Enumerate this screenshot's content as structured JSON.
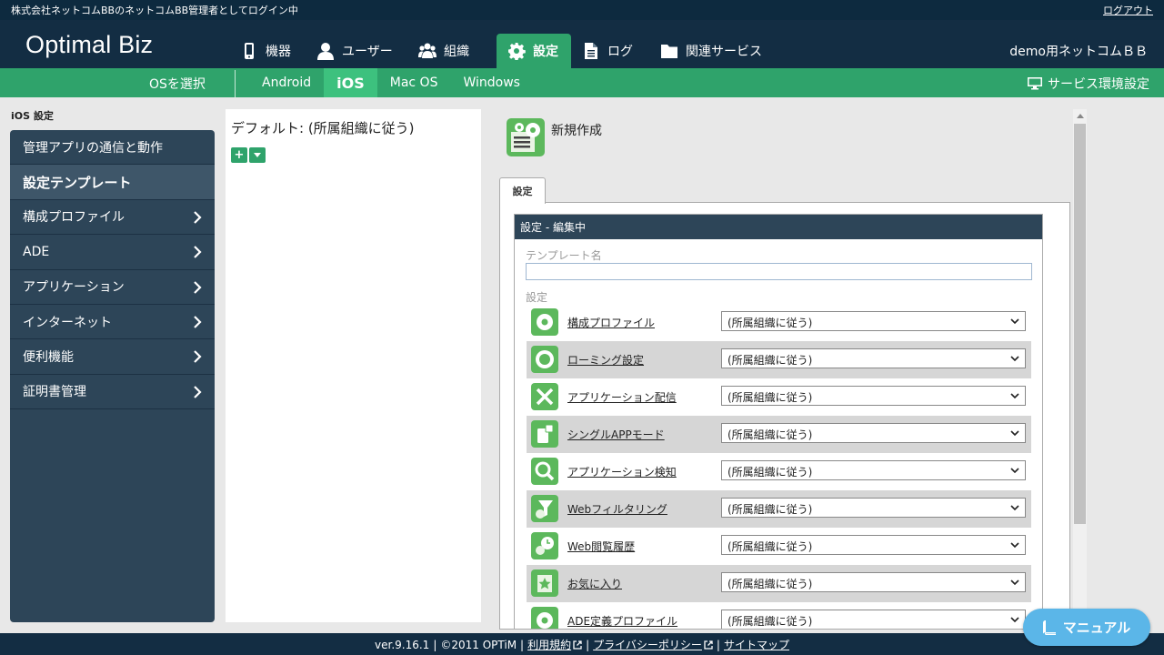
{
  "topbar": {
    "login_message": "株式会社ネットコムBBのネットコムBB管理者としてログイン中",
    "logout": "ログアウト"
  },
  "header": {
    "brand": "Optimal Biz",
    "nav": [
      {
        "label": "機器",
        "icon": "smartphone-icon"
      },
      {
        "label": "ユーザー",
        "icon": "user-icon"
      },
      {
        "label": "組織",
        "icon": "group-icon"
      },
      {
        "label": "設定",
        "icon": "gear-icon",
        "active": true
      },
      {
        "label": "ログ",
        "icon": "document-icon"
      },
      {
        "label": "関連サービス",
        "icon": "folder-icon"
      }
    ],
    "org_name": "demo用ネットコムＢＢ"
  },
  "osbar": {
    "select_os": "OSを選択",
    "tabs": [
      "Android",
      "iOS",
      "Mac OS",
      "Windows"
    ],
    "active_tab": "iOS",
    "service_env": "サービス環境設定"
  },
  "sidebar": {
    "heading": "iOS 設定",
    "items": [
      {
        "label": "管理アプリの通信と動作"
      },
      {
        "label": "設定テンプレート",
        "active": true
      },
      {
        "label": "構成プロファイル"
      },
      {
        "label": "ADE"
      },
      {
        "label": "アプリケーション"
      },
      {
        "label": "インターネット"
      },
      {
        "label": "便利機能"
      },
      {
        "label": "証明書管理"
      }
    ]
  },
  "middle": {
    "default_label": "デフォルト: (所属組織に従う)",
    "add_button": "+"
  },
  "editor": {
    "title": "新規作成",
    "tab": "設定",
    "box_title": "設定 - 編集中",
    "template_name_label": "テンプレート名",
    "template_name_value": "",
    "settings_label": "設定",
    "rows": [
      {
        "label": "構成プロファイル",
        "value": "(所属組織に従う)",
        "icon": "gear-icon"
      },
      {
        "label": "ローミング設定",
        "value": "(所属組織に従う)",
        "icon": "globe-icon"
      },
      {
        "label": "アプリケーション配信",
        "value": "(所属組織に従う)",
        "icon": "tools-icon"
      },
      {
        "label": "シングルAPPモード",
        "value": "(所属組織に従う)",
        "icon": "lock-app-icon"
      },
      {
        "label": "アプリケーション検知",
        "value": "(所属組織に従う)",
        "icon": "search-icon"
      },
      {
        "label": "Webフィルタリング",
        "value": "(所属組織に従う)",
        "icon": "filter-icon"
      },
      {
        "label": "Web閲覧履歴",
        "value": "(所属組織に従う)",
        "icon": "clock-icon"
      },
      {
        "label": "お気に入り",
        "value": "(所属組織に従う)",
        "icon": "star-icon"
      },
      {
        "label": "ADE定義プロファイル",
        "value": "(所属組織に従う)",
        "icon": "gear-icon"
      }
    ]
  },
  "footer": {
    "version": "ver.9.16.1",
    "copyright": "©2011 OPTiM",
    "terms": "利用規約",
    "privacy": "プライバシーポリシー",
    "sitemap": "サイトマップ"
  },
  "manual_button": "マニュアル",
  "colors": {
    "navy": "#132d43",
    "green": "#2fa36b",
    "sidebar": "#2d4558",
    "manual": "#5bb6e8"
  }
}
